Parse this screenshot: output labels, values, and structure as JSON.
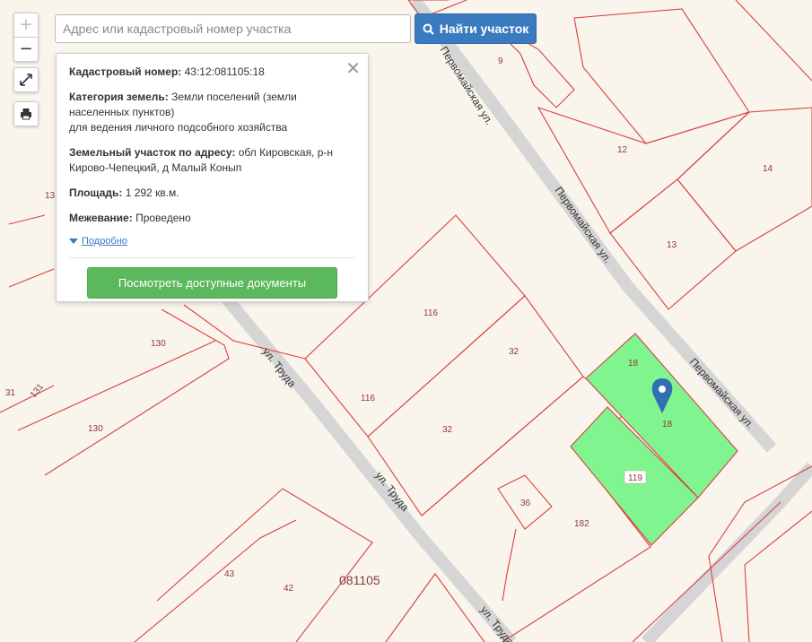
{
  "search": {
    "placeholder": "Адрес или кадастровый номер участка",
    "button_label": "Найти участок"
  },
  "controls": {
    "zoom_in": "+",
    "zoom_out": "−"
  },
  "popup": {
    "cadastral_label": "Кадастровый номер:",
    "cadastral_value": "43:12:081105:18",
    "category_label": "Категория земель:",
    "category_value": "Земли поселений (земли населенных пунктов)",
    "category_value_2": "для ведения личного подсобного хозяйства",
    "address_label": "Земельный участок по адресу:",
    "address_value": "обл Кировская, р-н Кирово-Чепецкий, д Малый Конып",
    "area_label": "Площадь:",
    "area_value": "1 292 кв.м.",
    "survey_label": "Межевание:",
    "survey_value": "Проведено",
    "details_link": "Подробно",
    "docs_button": "Посмотреть доступные документы"
  },
  "map": {
    "streets": {
      "pervomayskaya_1": "Первомайская ул.",
      "pervomayskaya_2": "Первомайская ул.",
      "pervomayskaya_3": "Первомайская ул.",
      "truda_1": "ул. Труда",
      "truda_2": "ул. Труда",
      "truda_3": "ул. Труда"
    },
    "quarter": "081105",
    "parcels": {
      "p9": "9",
      "p12": "12",
      "p14": "14",
      "p13": "13",
      "p13b": "13",
      "p116a": "116",
      "p116b": "116",
      "p32a": "32",
      "p32b": "32",
      "p130a": "130",
      "p130b": "130",
      "p131": "131",
      "p31": "31",
      "p18a": "18",
      "p18b": "18",
      "p119": "119",
      "p36": "36",
      "p182": "182",
      "p43": "43",
      "p42": "42"
    },
    "colors": {
      "selected_fill": "#80f58f",
      "border": "#d94040",
      "marker": "#2f6fb3"
    }
  }
}
